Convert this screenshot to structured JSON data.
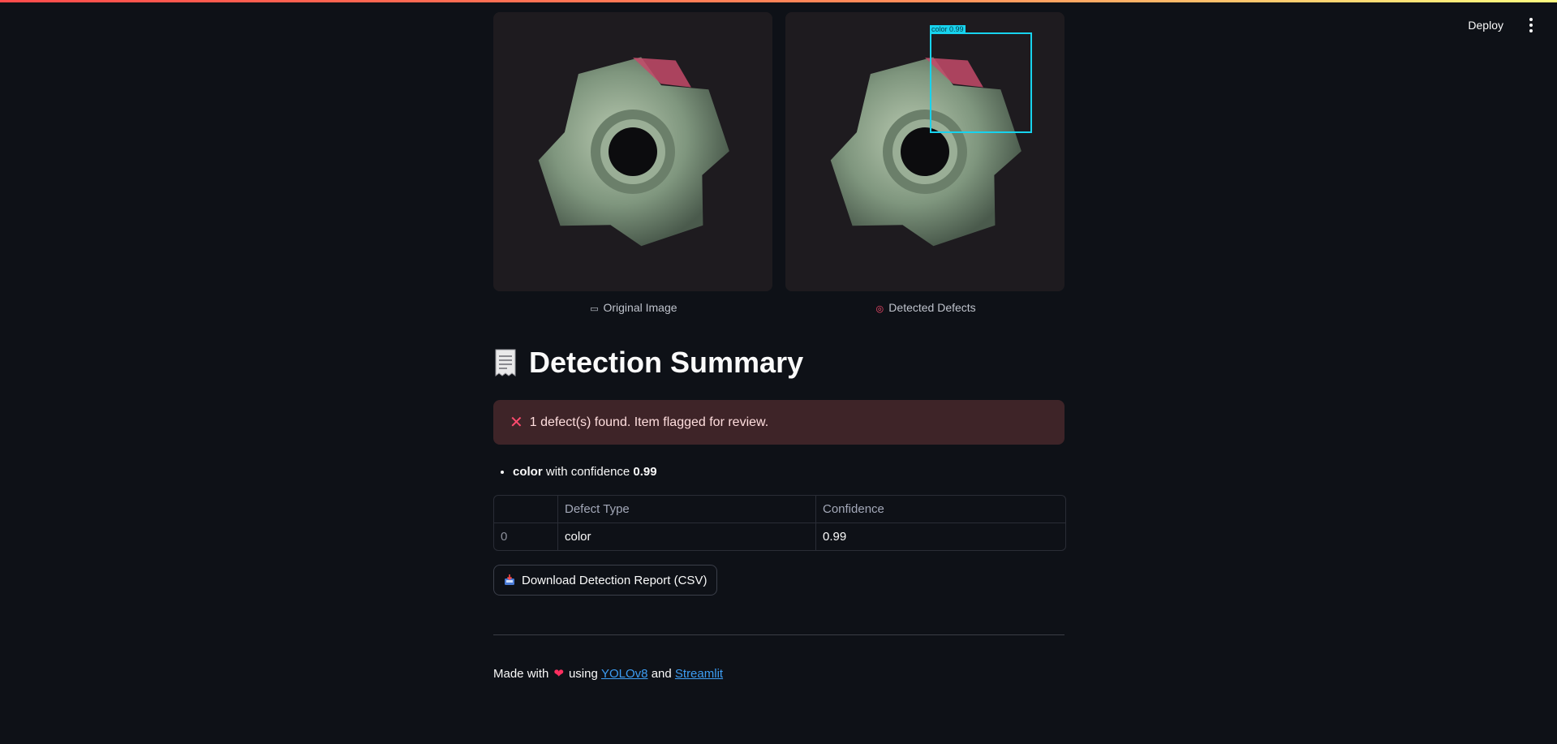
{
  "header": {
    "deploy_label": "Deploy",
    "menu_icon": "kebab-menu-icon"
  },
  "images": {
    "original_caption": "Original Image",
    "original_icon": "camera-icon",
    "detected_caption": "Detected Defects",
    "detected_icon": "target-icon",
    "detection_label": "color 0.99",
    "box_color": "#17d3ee"
  },
  "summary": {
    "title": "Detection Summary",
    "title_icon": "receipt-icon",
    "alert_text": "1 defect(s) found. Item flagged for review.",
    "alert_icon": "x-mark-icon",
    "defects": [
      {
        "type": "color",
        "mid_text": " with confidence ",
        "confidence": "0.99"
      }
    ]
  },
  "table": {
    "headers": [
      "",
      "Defect Type",
      "Confidence"
    ],
    "rows": [
      [
        "0",
        "color",
        "0.99"
      ]
    ]
  },
  "download": {
    "label": "Download Detection Report (CSV)",
    "icon": "inbox-tray-icon"
  },
  "footer": {
    "prefix": "Made with",
    "middle": "using",
    "link1": "YOLOv8",
    "and": "and",
    "link2": "Streamlit"
  },
  "colors": {
    "background": "#0e1117",
    "alert_bg": "#3e2428",
    "link": "#3d9df3"
  }
}
